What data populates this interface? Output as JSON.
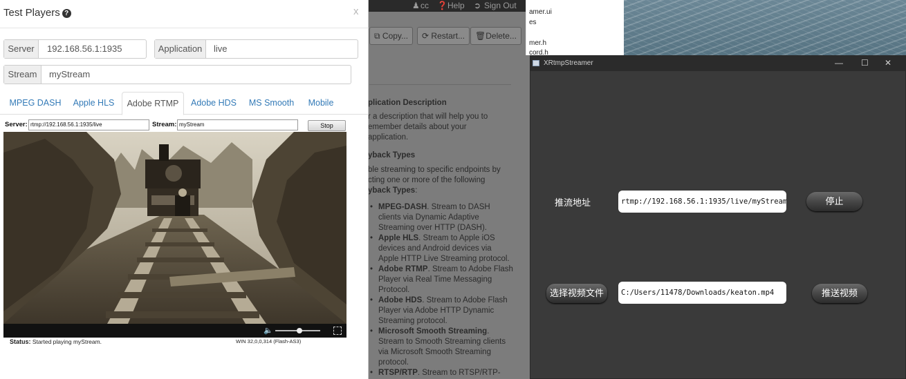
{
  "background_app": {
    "topbar": {
      "user": "cc",
      "help": "Help",
      "signout": "Sign Out"
    },
    "buttons": {
      "copy": "Copy...",
      "restart": "Restart...",
      "delete": "Delete..."
    },
    "description_heading": "plication Description",
    "description_text": "r a description that will help you to emember details about your application.",
    "playback_heading": "yback Types",
    "playback_intro": "ble streaming to specific endpoints by cting one or more of the following",
    "playback_intro_bold": "yback Types",
    "playback_items": [
      {
        "bold": "MPEG-DASH",
        "text": ". Stream to DASH clients via Dynamic Adaptive Streaming over HTTP (DASH)."
      },
      {
        "bold": "Apple HLS",
        "text": ". Stream to Apple iOS devices and Android devices via Apple HTTP Live Streaming protocol."
      },
      {
        "bold": "Adobe RTMP",
        "text": ". Stream to Adobe Flash Player via Real Time Messaging Protocol."
      },
      {
        "bold": "Adobe HDS",
        "text": ". Stream to Adobe Flash Player via Adobe HTTP Dynamic Streaming protocol."
      },
      {
        "bold": "Microsoft Smooth Streaming",
        "text": ". Stream to Smooth Streaming clients via Microsoft Smooth Streaming protocol."
      },
      {
        "bold": "RTSP/RTP",
        "text": ". Stream to RTSP/RTP-based players and devices (including"
      }
    ]
  },
  "explorer": {
    "files": [
      "amer.ui",
      "es",
      "mer.h",
      "cord.h"
    ]
  },
  "xrtmp": {
    "title": "XRtmpStreamer",
    "window_buttons": {
      "minimize": "—",
      "maximize": "☐",
      "close": "✕"
    },
    "push_url_label": "推流地址",
    "push_url_value": "rtmp://192.168.56.1:1935/live/myStream",
    "stop_button": "停止",
    "choose_file_button": "选择视频文件",
    "file_path_value": "C:/Users/11478/Downloads/keaton.mp4",
    "push_video_button": "推送视频"
  },
  "modal": {
    "title": "Test Players",
    "close": "x",
    "server_label": "Server",
    "server_value": "192.168.56.1:1935",
    "application_label": "Application",
    "application_value": "live",
    "stream_label": "Stream",
    "stream_value": "myStream",
    "tabs": [
      "MPEG DASH",
      "Apple HLS",
      "Adobe RTMP",
      "Adobe HDS",
      "MS Smooth",
      "Mobile"
    ],
    "active_tab": "Adobe RTMP",
    "player": {
      "server_label": "Server:",
      "server_value": "rtmp://192.168.56.1:1935/live",
      "stream_label": "Stream:",
      "stream_value": "myStream",
      "stop_button": "Stop",
      "status_label": "Status:",
      "status_value": "Started playing myStream.",
      "version": "WIN 32,0,0,314 (Flash-AS3)"
    }
  }
}
